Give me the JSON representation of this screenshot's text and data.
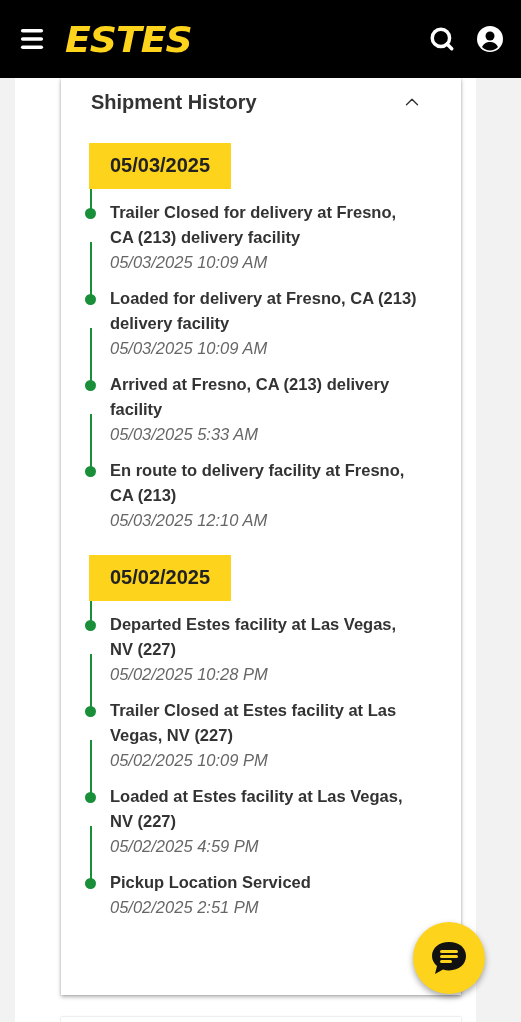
{
  "header": {
    "logo": "ESTES"
  },
  "shipment_history": {
    "title": "Shipment History",
    "expanded": true,
    "days": [
      {
        "date": "05/03/2025",
        "events": [
          {
            "title": "Trailer Closed for delivery at Fresno, CA (213) delivery facility",
            "time": "05/03/2025 10:09 AM"
          },
          {
            "title": "Loaded for delivery at Fresno, CA (213) delivery facility",
            "time": "05/03/2025 10:09 AM"
          },
          {
            "title": "Arrived at Fresno, CA (213) delivery facility",
            "time": "05/03/2025 5:33 AM"
          },
          {
            "title": "En route to delivery facility at Fresno, CA (213)",
            "time": "05/03/2025 12:10 AM"
          }
        ]
      },
      {
        "date": "05/02/2025",
        "events": [
          {
            "title": "Departed Estes facility at Las Vegas, NV (227)",
            "time": "05/02/2025 10:28 PM"
          },
          {
            "title": "Trailer Closed at Estes facility at Las Vegas, NV (227)",
            "time": "05/02/2025 10:09 PM"
          },
          {
            "title": "Loaded at Estes facility at Las Vegas, NV (227)",
            "time": "05/02/2025 4:59 PM"
          },
          {
            "title": "Pickup Location Serviced",
            "time": "05/02/2025 2:51 PM"
          }
        ]
      }
    ]
  }
}
